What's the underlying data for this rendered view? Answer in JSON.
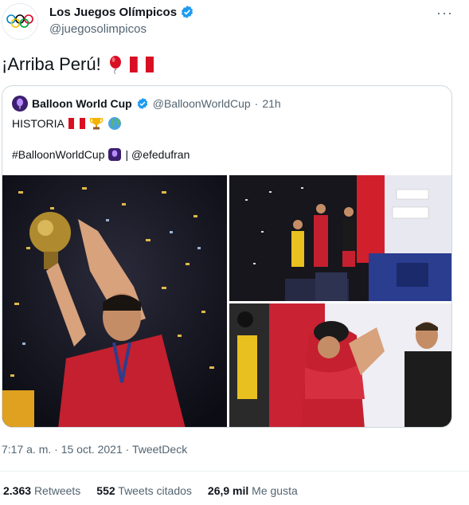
{
  "author": {
    "display_name": "Los Juegos Olímpicos",
    "handle": "@juegosolimpicos"
  },
  "tweet": {
    "text": "¡Arriba Perú!"
  },
  "quoted": {
    "display_name": "Balloon World Cup",
    "handle": "@BalloonWorldCup",
    "separator": "·",
    "time": "21h",
    "line1": "HISTORIA",
    "hashtag": "#BalloonWorldCup",
    "credit": "| @efedufran"
  },
  "meta": {
    "timestamp": "7:17 a. m. · 15 oct. 2021 · TweetDeck"
  },
  "stats": [
    {
      "num": "2.363",
      "label": "Retweets"
    },
    {
      "num": "552",
      "label": "Tweets citados"
    },
    {
      "num": "26,9 mil",
      "label": "Me gusta"
    }
  ],
  "colors": {
    "verified_blue": "#1d9bf0",
    "peru_red": "#d91023",
    "border": "#cfd9de",
    "secondary_text": "#536471"
  },
  "icons": [
    "olympic-rings-icon",
    "verified-badge-icon",
    "more-options-icon",
    "balloon-emoji-icon",
    "peru-flag-icon",
    "trophy-emoji-icon",
    "globe-emoji-icon",
    "balloon-world-cup-logo-icon"
  ]
}
